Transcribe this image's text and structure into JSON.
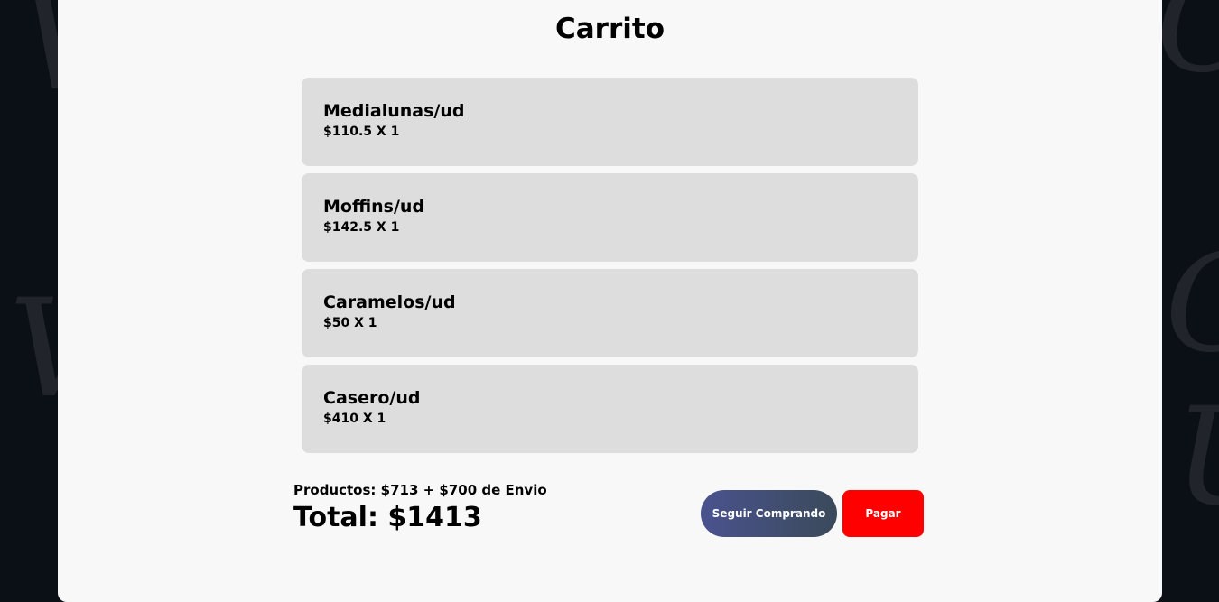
{
  "cart": {
    "title": "Carrito",
    "items": [
      {
        "name": "Medialunas/ud",
        "price": "$110.5 X 1"
      },
      {
        "name": "Moffins/ud",
        "price": "$142.5 X 1"
      },
      {
        "name": "Caramelos/ud",
        "price": "$50 X 1"
      },
      {
        "name": "Casero/ud",
        "price": "$410 X 1"
      }
    ],
    "subtotal": "Productos: $713 + $700 de Envio",
    "total": "Total: $1413",
    "continue_label": "Seguir Comprando",
    "pay_label": "Pagar"
  },
  "colors": {
    "background": "#0b0f16",
    "panel": "#f8f8f8",
    "item_bg": "#dddddd",
    "pay_button": "#ff0000",
    "continue_button_start": "#4a538e",
    "continue_button_end": "#3a4a5a"
  }
}
